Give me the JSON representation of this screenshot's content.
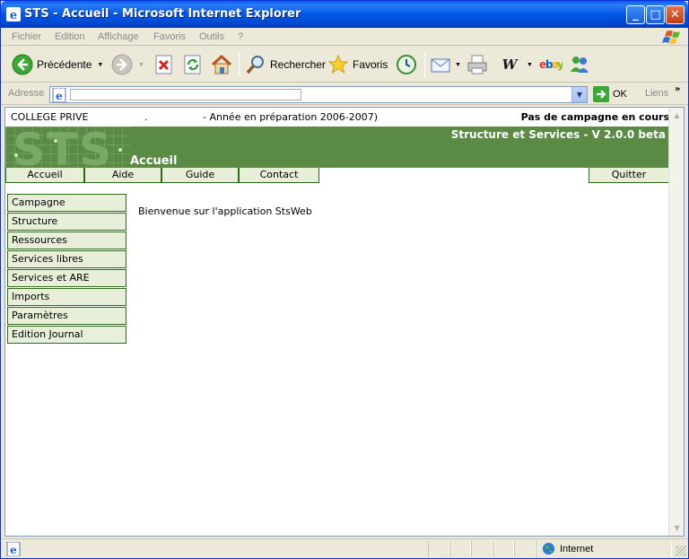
{
  "window": {
    "title": "STS - Accueil - Microsoft Internet Explorer",
    "minimize": "_",
    "maximize": "□",
    "close": "✕"
  },
  "menu": [
    "Fichier",
    "Edition",
    "Affichage",
    "Favoris",
    "Outils",
    "?"
  ],
  "toolbar": {
    "back_label": "Précédente",
    "search_label": "Rechercher",
    "favorites_label": "Favoris",
    "dropdown_glyph": "▼"
  },
  "address": {
    "label": "Adresse",
    "value": "",
    "go_label": "OK",
    "links_label": "Liens",
    "chevron": "»",
    "dropdown_glyph": "▼"
  },
  "page": {
    "college": "COLLEGE PRIVE",
    "separator_dot": ".",
    "annee": "- Année en préparation 2006-2007)",
    "campagne": "Pas de campagne en cours",
    "logo": "STS",
    "version": "Structure et Services - V 2.0.0 beta",
    "heading": "Accueil",
    "nav": [
      "Accueil",
      "Aide",
      "Guide",
      "Contact"
    ],
    "quit": "Quitter",
    "side_menu": [
      "Campagne",
      "Structure",
      "Ressources",
      "Services libres",
      "Services et ARE",
      "Imports",
      "Paramètres",
      "Edition Journal"
    ],
    "welcome": "Bienvenue sur l'application StsWeb"
  },
  "status": {
    "zone": "Internet"
  },
  "colors": {
    "banner_green": "#5a8a44",
    "button_bg": "#e8efd8",
    "button_border": "#2f6a1a",
    "titlebar_blue": "#0058e6"
  }
}
